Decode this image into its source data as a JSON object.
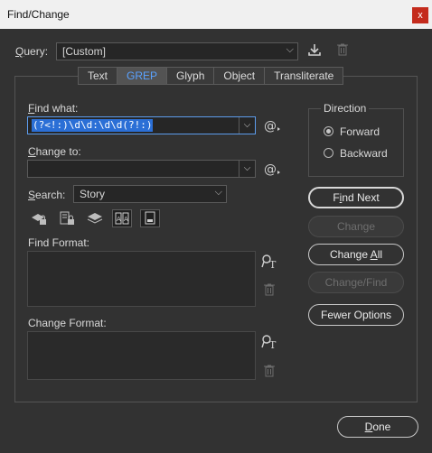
{
  "window": {
    "title": "Find/Change",
    "close_glyph": "x"
  },
  "query": {
    "label": "Query:",
    "value": "[Custom]"
  },
  "icons": {
    "save_query": "save-query-icon",
    "delete_query": "delete-query-icon",
    "special_chars": "special-characters-icon",
    "format_search": "specify-format-icon",
    "format_delete": "clear-format-icon"
  },
  "tabs": [
    {
      "label": "Text"
    },
    {
      "label": "GREP",
      "active": true
    },
    {
      "label": "Glyph"
    },
    {
      "label": "Object"
    },
    {
      "label": "Transliterate"
    }
  ],
  "find_what": {
    "label": "Find what:",
    "value": "(?<!:)\\d\\d:\\d\\d(?!:)"
  },
  "change_to": {
    "label": "Change to:",
    "value": ""
  },
  "search": {
    "label": "Search:",
    "value": "Story"
  },
  "options_icons": [
    "include-locked-layers-icon",
    "include-locked-stories-icon",
    "include-hidden-layers-icon",
    "include-master-pages-icon",
    "include-footnotes-icon"
  ],
  "find_format": {
    "label": "Find Format:"
  },
  "change_format": {
    "label": "Change Format:"
  },
  "direction": {
    "title": "Direction",
    "forward": "Forward",
    "backward": "Backward",
    "selected": "Forward"
  },
  "buttons": {
    "find_next": "Find Next",
    "change": "Change",
    "change_all": "Change All",
    "change_find": "Change/Find",
    "fewer_options": "Fewer Options",
    "done": "Done"
  },
  "colors": {
    "background": "#323232",
    "accent": "#5aa2ff",
    "selection": "#2b6fd6",
    "close": "#c42b1c"
  }
}
